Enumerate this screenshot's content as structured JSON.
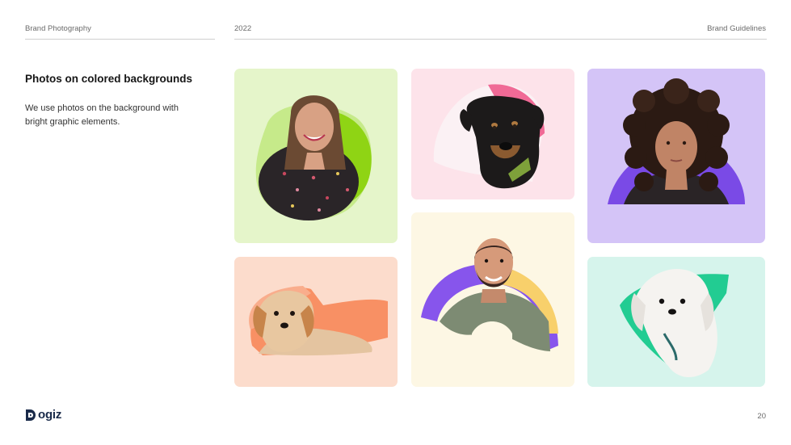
{
  "header": {
    "section": "Brand Photography",
    "year": "2022",
    "doc_title": "Brand Guidelines"
  },
  "content": {
    "title": "Photos on colored backgrounds",
    "description": "We use photos on the background with bright graphic elements."
  },
  "cards": [
    {
      "subject": "woman-smiling",
      "bg": "#e5f5ca",
      "shape": "#8fd414"
    },
    {
      "subject": "black-tan-dog",
      "bg": "#fde3ea",
      "shape": "#f06a96"
    },
    {
      "subject": "woman-curly-hair",
      "bg": "#d4c4f7",
      "shape": "#7a4ae6"
    },
    {
      "subject": "fluffy-dog-lying",
      "bg": "#fcdccc",
      "shape": "#f89064"
    },
    {
      "subject": "bearded-man",
      "bg": "#fdf7e4",
      "shape": "#8755ec"
    },
    {
      "subject": "white-maltese-dog",
      "bg": "#d6f4ec",
      "shape": "#22cc92"
    }
  ],
  "footer": {
    "logo_text": "ogiz",
    "page_number": "20"
  }
}
